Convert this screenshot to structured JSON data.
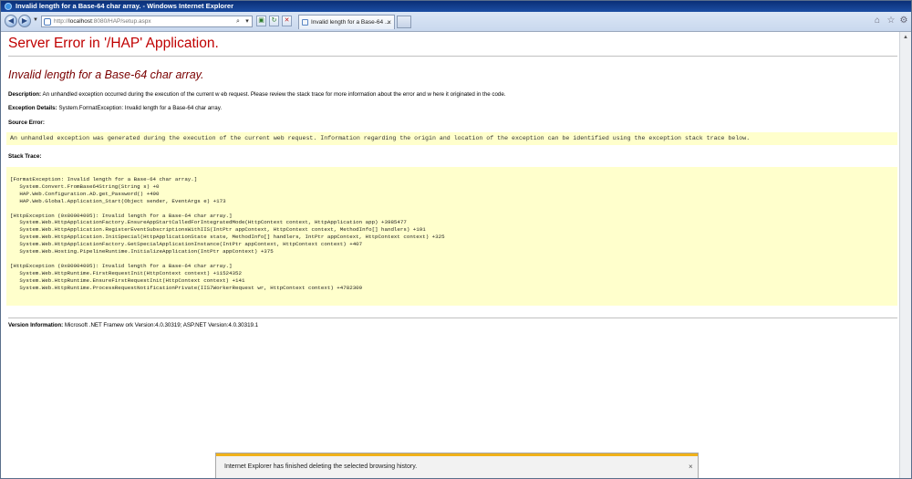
{
  "window": {
    "title": "Invalid length for a Base-64 char array. - Windows Internet Explorer"
  },
  "address_bar": {
    "protocol": "http://",
    "host": "localhost",
    "rest": ":8080/HAP/setup.aspx"
  },
  "tab": {
    "title": "Invalid length for a Base-64 ..."
  },
  "page": {
    "heading": "Server Error in '/HAP' Application.",
    "subheading": "Invalid length for a Base-64 char array.",
    "description_label": "Description:",
    "description_text": "An unhandled exception occurred during the execution of the current w eb request. Please review the stack trace for more information about the error and w here it originated in the code.",
    "exception_label": "Exception Details:",
    "exception_text": "System.FormatException: Invalid length for a Base-64 char array.",
    "source_error_label": "Source Error:",
    "source_error_text": "An unhandled exception was generated during the execution of the current web request. Information regarding the origin and location of the exception can be identified using the exception stack trace below.",
    "stack_trace_label": "Stack Trace:",
    "stack_trace": "[FormatException: Invalid length for a Base-64 char array.]\n   System.Convert.FromBase64String(String s) +0\n   HAP.Web.Configuration.AD.get_Password() +490\n   HAP.Web.Global.Application_Start(Object sender, EventArgs e) +173\n\n[HttpException (0x80004005): Invalid length for a Base-64 char array.]\n   System.Web.HttpApplicationFactory.EnsureAppStartCalledForIntegratedMode(HttpContext context, HttpApplication app) +3985477\n   System.Web.HttpApplication.RegisterEventSubscriptionsWithIIS(IntPtr appContext, HttpContext context, MethodInfo[] handlers) +191\n   System.Web.HttpApplication.InitSpecial(HttpApplicationState state, MethodInfo[] handlers, IntPtr appContext, HttpContext context) +325\n   System.Web.HttpApplicationFactory.GetSpecialApplicationInstance(IntPtr appContext, HttpContext context) +407\n   System.Web.Hosting.PipelineRuntime.InitializeApplication(IntPtr appContext) +375\n\n[HttpException (0x80004005): Invalid length for a Base-64 char array.]\n   System.Web.HttpRuntime.FirstRequestInit(HttpContext context) +11524352\n   System.Web.HttpRuntime.EnsureFirstRequestInit(HttpContext context) +141\n   System.Web.HttpRuntime.ProcessRequestNotificationPrivate(IIS7WorkerRequest wr, HttpContext context) +4782309",
    "version_label": "Version Information:",
    "version_text": "Microsoft .NET Framew ork Version:4.0.30319; ASP.NET Version:4.0.30319.1"
  },
  "notification": {
    "text": "Internet Explorer has finished deleting the selected browsing history.",
    "close": "×"
  },
  "icons": {
    "back": "back-arrow-icon",
    "forward": "forward-arrow-icon",
    "search": "search-icon",
    "refresh": "refresh-icon",
    "stop": "stop-icon",
    "home": "home-icon",
    "favorites": "star-icon",
    "tools": "gear-icon"
  },
  "colors": {
    "error_heading": "#c00000",
    "subheading": "#7a0000",
    "code_background": "#ffffcc",
    "title_bar": "#0a2f77",
    "notification_strip": "#f0b11a"
  }
}
